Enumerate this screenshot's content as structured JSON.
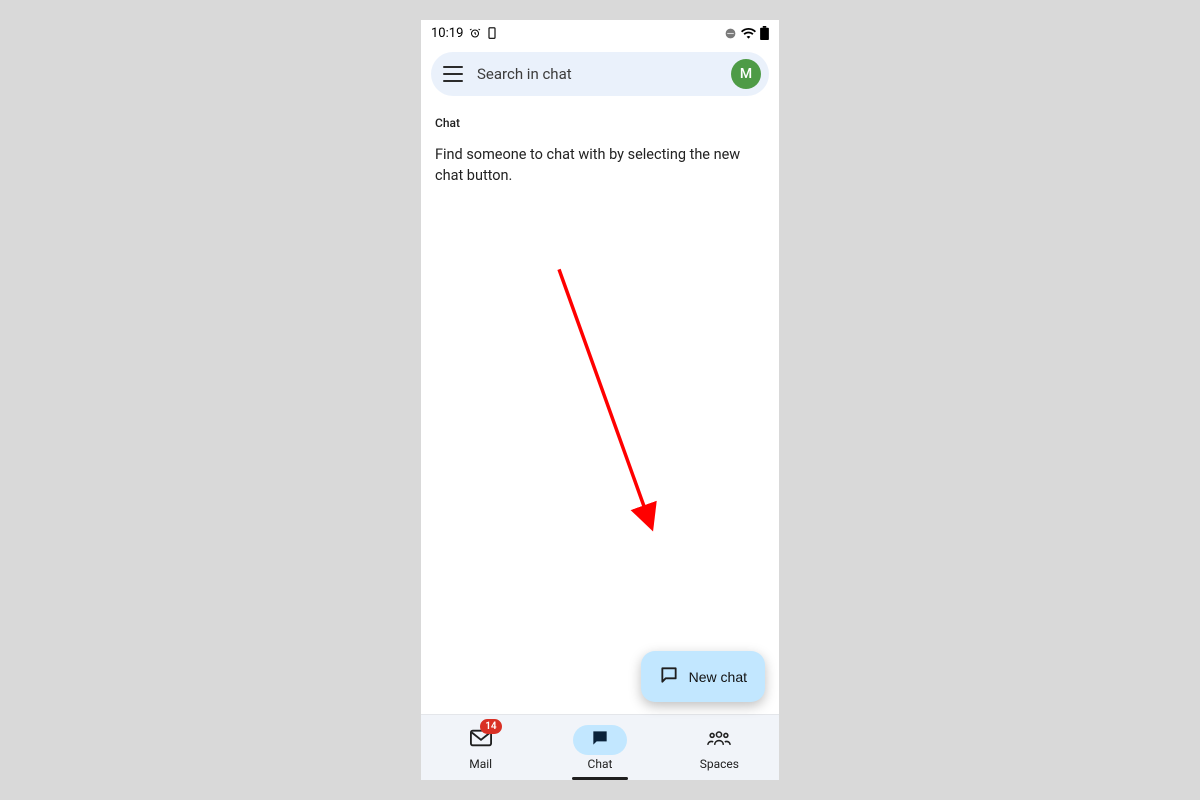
{
  "status_bar": {
    "time": "10:19"
  },
  "search": {
    "placeholder": "Search in chat",
    "avatar_initial": "M"
  },
  "section_label": "Chat",
  "empty_message": "Find someone to chat with by selecting the new chat button.",
  "fab": {
    "label": "New chat"
  },
  "nav": {
    "mail": {
      "label": "Mail",
      "badge": "14"
    },
    "chat": {
      "label": "Chat"
    },
    "spaces": {
      "label": "Spaces"
    }
  },
  "annotation": {
    "arrow_color": "#ff0000"
  }
}
